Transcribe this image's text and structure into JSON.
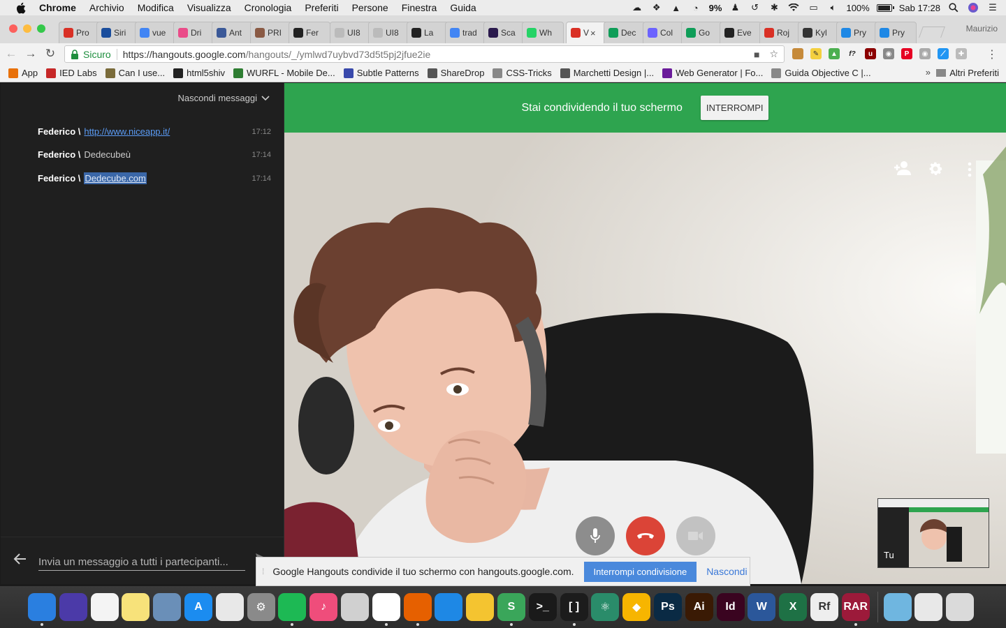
{
  "menubar": {
    "app_name": "Chrome",
    "items": [
      "Archivio",
      "Modifica",
      "Visualizza",
      "Cronologia",
      "Preferiti",
      "Persone",
      "Finestra",
      "Guida"
    ],
    "status": {
      "cpu_percent": "9%",
      "battery": "100%",
      "battery_level": 1.0,
      "clock": "Sab 17:28"
    }
  },
  "tabs": [
    {
      "title": "Pro",
      "icon": "gmail-icon",
      "color": "#d93025"
    },
    {
      "title": "Siri",
      "icon": "news-icon",
      "color": "#1a4d9c"
    },
    {
      "title": "vue",
      "icon": "google-icon",
      "color": "#4285f4"
    },
    {
      "title": "Dri",
      "icon": "dribbble-icon",
      "color": "#ea4c89"
    },
    {
      "title": "Ant",
      "icon": "facebook-icon",
      "color": "#3b5998"
    },
    {
      "title": "PRI",
      "icon": "page-icon",
      "color": "#8a5a44"
    },
    {
      "title": "Fer",
      "icon": "circle-icon",
      "color": "#222222"
    },
    {
      "title": "UI8",
      "icon": "blank-page-icon",
      "color": "#bbbbbb"
    },
    {
      "title": "UI8",
      "icon": "blank-page-icon",
      "color": "#bbbbbb"
    },
    {
      "title": "La",
      "icon": "circle-icon",
      "color": "#222222"
    },
    {
      "title": "trad",
      "icon": "google-icon",
      "color": "#4285f4"
    },
    {
      "title": "Sca",
      "icon": "b-icon",
      "color": "#2b1a4d"
    },
    {
      "title": "Wh",
      "icon": "whatsapp-icon",
      "color": "#25d366"
    },
    {
      "title": "V",
      "icon": "recording-icon",
      "color": "#d93025",
      "active": true
    },
    {
      "title": "Dec",
      "icon": "hangouts-icon",
      "color": "#0f9d58"
    },
    {
      "title": "Col",
      "icon": "c-icon",
      "color": "#6c63ff"
    },
    {
      "title": "Go",
      "icon": "maps-icon",
      "color": "#0f9d58"
    },
    {
      "title": "Eve",
      "icon": "camera-icon",
      "color": "#222222"
    },
    {
      "title": "Roj",
      "icon": "r-icon",
      "color": "#d93025"
    },
    {
      "title": "Kyl",
      "icon": "kylie-icon",
      "color": "#333333"
    },
    {
      "title": "Pry",
      "icon": "p-icon",
      "color": "#1e88e5"
    },
    {
      "title": "Pry",
      "icon": "p-icon",
      "color": "#1e88e5"
    }
  ],
  "profile_name": "Maurizio",
  "address_bar": {
    "secure_label": "Sicuro",
    "url_host": "https://hangouts.google.com",
    "url_path": "/hangouts/_/ymlwd7uybvd73d5t5pj2jfue2ie"
  },
  "bookmarks": [
    {
      "label": "App",
      "icon": "apps-grid-icon",
      "color": "#e8710a"
    },
    {
      "label": "IED Labs",
      "icon": "ied-icon",
      "color": "#c62828"
    },
    {
      "label": "Can I use...",
      "icon": "caniuse-icon",
      "color": "#7a6b3a"
    },
    {
      "label": "html5shiv",
      "icon": "github-icon",
      "color": "#222222"
    },
    {
      "label": "WURFL - Mobile De...",
      "icon": "wurfl-icon",
      "color": "#2e7d32"
    },
    {
      "label": "Subtle Patterns",
      "icon": "pattern-icon",
      "color": "#3949ab"
    },
    {
      "label": "ShareDrop",
      "icon": "sharedrop-icon",
      "color": "#555555"
    },
    {
      "label": "CSS-Tricks",
      "icon": "page-icon",
      "color": "#888888"
    },
    {
      "label": "Marchetti Design |...",
      "icon": "chevron-icon",
      "color": "#555555"
    },
    {
      "label": "Web Generator | Fo...",
      "icon": "web-generator-icon",
      "color": "#6a1b9a"
    },
    {
      "label": "Guida Objective C |...",
      "icon": "page-icon",
      "color": "#888888"
    }
  ],
  "bookmarks_other": "Altri Preferiti",
  "chat": {
    "hide_label": "Nascondi messaggi",
    "messages": [
      {
        "author": "Federico \\",
        "text": "http://www.niceapp.it/",
        "kind": "link",
        "time": "17:12"
      },
      {
        "author": "Federico \\",
        "text": "Dedecubeù",
        "kind": "plain",
        "time": "17:14"
      },
      {
        "author": "Federico \\",
        "text": "Dedecube.com",
        "kind": "selected",
        "time": "17:14"
      }
    ],
    "input_placeholder": "Invia un messaggio a tutti i partecipanti..."
  },
  "banner": {
    "text": "Stai condividendo il tuo schermo",
    "button": "INTERROMPI",
    "color": "#2ea44f"
  },
  "video": {
    "self_label": "Tu"
  },
  "share_notice": {
    "text": "Google Hangouts condivide il tuo schermo con hangouts.google.com.",
    "stop_button": "Interrompi condivisione",
    "hide_link": "Nascondi"
  },
  "dock": [
    {
      "name": "finder",
      "label": "",
      "color": "#2a7fe0",
      "running": true
    },
    {
      "name": "siri",
      "label": "",
      "color": "#4b3aa8",
      "running": false
    },
    {
      "name": "photos",
      "label": "",
      "color": "#f4f4f4",
      "running": false
    },
    {
      "name": "notes",
      "label": "",
      "color": "#f7e27a",
      "running": false
    },
    {
      "name": "preview",
      "label": "",
      "color": "#6a8fb8",
      "running": false
    },
    {
      "name": "app-store",
      "label": "A",
      "color": "#1b8cf0",
      "running": false
    },
    {
      "name": "textedit",
      "label": "",
      "color": "#e8e8e8",
      "running": false
    },
    {
      "name": "system-preferences",
      "label": "⚙",
      "color": "#8a8a8a",
      "running": false
    },
    {
      "name": "spotify",
      "label": "",
      "color": "#1db954",
      "running": true
    },
    {
      "name": "itunes",
      "label": "♪",
      "color": "#ef4d7b",
      "running": false
    },
    {
      "name": "sequel-pro",
      "label": "",
      "color": "#d0d0d0",
      "running": false
    },
    {
      "name": "chrome",
      "label": "",
      "color": "#ffffff",
      "running": true
    },
    {
      "name": "firefox",
      "label": "",
      "color": "#e66000",
      "running": true
    },
    {
      "name": "safari",
      "label": "",
      "color": "#1e88e5",
      "running": false
    },
    {
      "name": "cyberduck",
      "label": "",
      "color": "#f4c430",
      "running": false
    },
    {
      "name": "shop",
      "label": "S",
      "color": "#3aa65a",
      "running": true
    },
    {
      "name": "terminal",
      "label": ">_",
      "color": "#1a1a1a",
      "running": false
    },
    {
      "name": "app-bracket",
      "label": "[ ]",
      "color": "#1c1c1c",
      "running": true
    },
    {
      "name": "atom",
      "label": "⚛",
      "color": "#2a8c6a",
      "running": false
    },
    {
      "name": "sketch",
      "label": "◆",
      "color": "#f7b500",
      "running": false
    },
    {
      "name": "photoshop",
      "label": "Ps",
      "color": "#0a2a44",
      "running": false
    },
    {
      "name": "illustrator",
      "label": "Ai",
      "color": "#3a1a04",
      "running": false
    },
    {
      "name": "indesign",
      "label": "Id",
      "color": "#3a0420",
      "running": false
    },
    {
      "name": "word",
      "label": "W",
      "color": "#2b579a",
      "running": false
    },
    {
      "name": "excel",
      "label": "X",
      "color": "#1e7145",
      "running": false
    },
    {
      "name": "reflector",
      "label": "Rf",
      "color": "#eeeeee",
      "running": false
    },
    {
      "name": "rar",
      "label": "RAR",
      "color": "#9c1a3a",
      "running": true
    },
    {
      "name": "downloads",
      "label": "",
      "color": "#6fb6e0",
      "running": false
    },
    {
      "name": "screenshot-folder",
      "label": "",
      "color": "#e8e8e8",
      "running": false
    },
    {
      "name": "trash",
      "label": "",
      "color": "#dadada",
      "running": false
    }
  ]
}
